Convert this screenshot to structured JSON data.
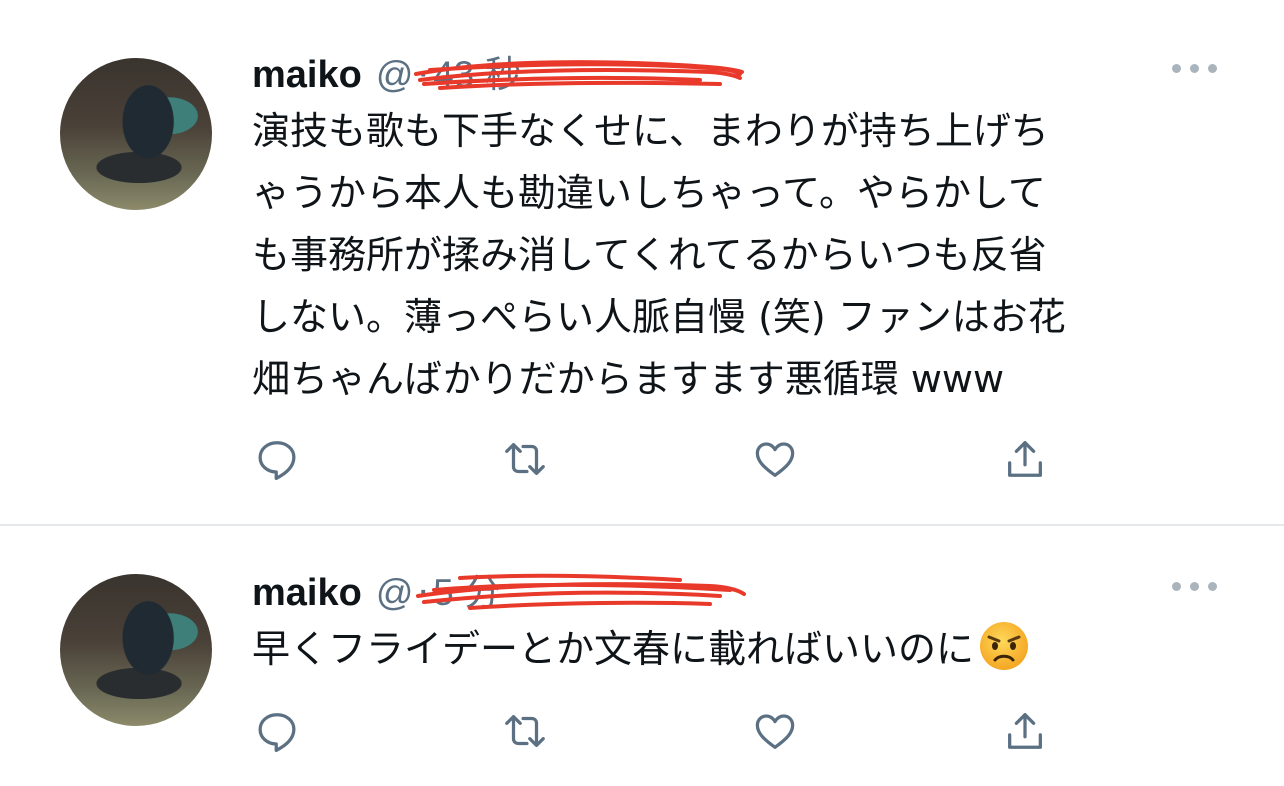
{
  "colors": {
    "text": "#0f1419",
    "secondary": "#5b7083",
    "divider": "#e6e9ec",
    "redaction": "#e8392a"
  },
  "tweets": [
    {
      "name": "maiko",
      "handle": "@",
      "separator": "·",
      "time": "43 秒",
      "text": "演技も歌も下手なくせに、まわりが持ち上げち\nゃうから本人も勘違いしちゃって。やらかして\nも事務所が揉み消してくれてるからいつも反省\nしない。薄っぺらい人脈自慢 (笑) ファンはお花\n畑ちゃんばかりだからますます悪循環 www",
      "icons": [
        "reply-icon",
        "retweet-icon",
        "like-icon",
        "share-icon"
      ]
    },
    {
      "name": "maiko",
      "handle": "@",
      "separator": "·",
      "time": "5 分",
      "text": "早くフライデーとか文春に載ればいいのに",
      "emoji": "angry-face-emoji",
      "icons": [
        "reply-icon",
        "retweet-icon",
        "like-icon",
        "share-icon"
      ]
    }
  ]
}
